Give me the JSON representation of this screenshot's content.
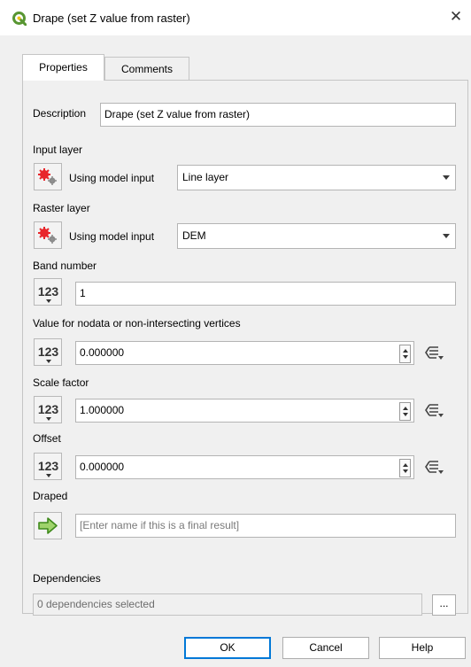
{
  "window": {
    "title": "Drape (set Z value from raster)",
    "close_glyph": "✕",
    "app_icon": "qgis-logo-icon"
  },
  "tabs": [
    {
      "label": "Properties",
      "active": true
    },
    {
      "label": "Comments",
      "active": false
    }
  ],
  "description": {
    "label": "Description",
    "value": "Drape (set Z value from raster)"
  },
  "params": {
    "input_layer": {
      "label": "Input layer",
      "source": "Using model input",
      "value": "Line layer"
    },
    "raster_layer": {
      "label": "Raster layer",
      "source": "Using model input",
      "value": "DEM"
    },
    "band_number": {
      "label": "Band number",
      "icon_text": "123",
      "value": "1"
    },
    "nodata": {
      "label": "Value for nodata or non-intersecting vertices",
      "icon_text": "123",
      "value": "0.000000"
    },
    "scale": {
      "label": "Scale factor",
      "icon_text": "123",
      "value": "1.000000"
    },
    "offset": {
      "label": "Offset",
      "icon_text": "123",
      "value": "0.000000"
    },
    "draped": {
      "label": "Draped",
      "placeholder": "[Enter name if this is a final result]"
    }
  },
  "dependencies": {
    "label": "Dependencies",
    "value": "0 dependencies selected",
    "button_label": "..."
  },
  "buttons": {
    "ok": "OK",
    "cancel": "Cancel",
    "help": "Help"
  },
  "colors": {
    "qgis_green": "#589632",
    "accent_blue": "#0078d7",
    "gear_red": "#e8262b"
  }
}
